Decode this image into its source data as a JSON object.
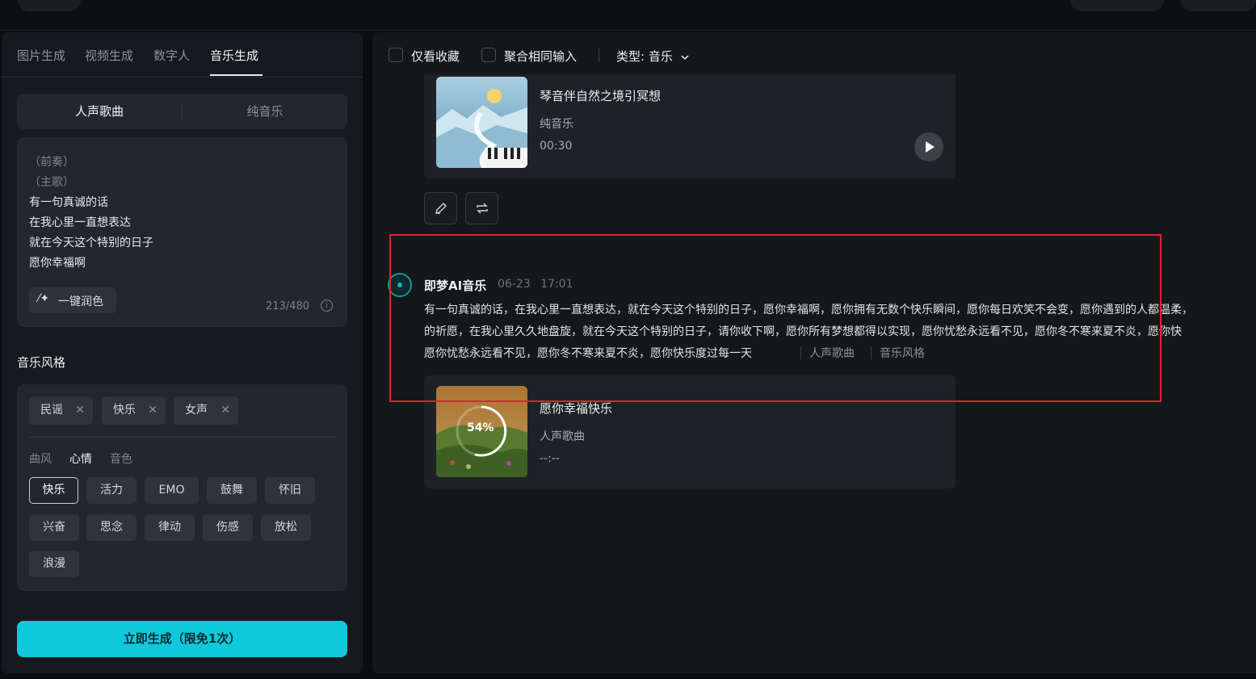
{
  "left": {
    "tabs": [
      "图片生成",
      "视频生成",
      "数字人",
      "音乐生成"
    ],
    "active_tab_index": 3,
    "segments": [
      "人声歌曲",
      "纯音乐"
    ],
    "active_segment_index": 0,
    "lyrics": {
      "lines_dim": [
        "（前奏）",
        "（主歌）"
      ],
      "lines": [
        "有一句真诚的话",
        "在我心里一直想表达",
        "就在今天这个特别的日子",
        "愿你幸福啊"
      ],
      "polish_label": "一键润色",
      "char_count": "213/480"
    },
    "style_title": "音乐风格",
    "selected_tags": [
      "民谣",
      "快乐",
      "女声"
    ],
    "categories": [
      "曲风",
      "心情",
      "音色"
    ],
    "active_category_index": 1,
    "moods_row1": [
      "快乐",
      "活力",
      "EMO",
      "鼓舞",
      "怀旧"
    ],
    "moods_row2": [
      "兴奋",
      "思念",
      "律动",
      "伤感",
      "放松"
    ],
    "moods_row3": [
      "浪漫"
    ],
    "active_mood": "快乐",
    "generate_label": "立即生成（限免1次）"
  },
  "right": {
    "filters": {
      "favorites_label": "仅看收藏",
      "merge_label": "聚合相同输入",
      "type_label": "类型: 音乐"
    },
    "track1": {
      "title": "琴音伴自然之境引冥想",
      "type": "纯音乐",
      "duration": "00:30"
    },
    "message": {
      "name": "即梦AI音乐",
      "date": "06-23",
      "time": "17:01",
      "line1": "有一句真诚的话，在我心里一直想表达，就在今天这个特别的日子，愿你幸福啊，愿你拥有无数个快乐瞬间，愿你每日欢笑不会变，愿你遇到的人都温柔，",
      "line2": "的祈愿，在我心里久久地盘旋，就在今天这个特别的日子，请你收下啊，愿你所有梦想都得以实现，愿你忧愁永远看不见，愿你冬不寒来夏不炎，愿你快",
      "line3": "愿你忧愁永远看不见，愿你冬不寒来夏不炎，愿你快乐度过每一天",
      "tag1": "人声歌曲",
      "tag2": "音乐风格"
    },
    "track2": {
      "title": "愿你幸福快乐",
      "type": "人声歌曲",
      "duration": "--:--",
      "progress": "54%"
    }
  },
  "colors": {
    "accent": "#0ec9dc",
    "highlight_border": "#e0242b"
  }
}
